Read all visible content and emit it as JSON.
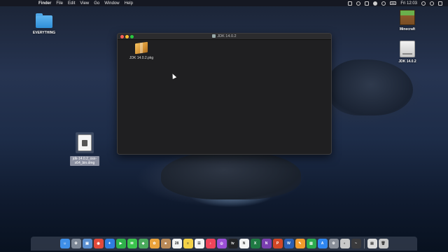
{
  "menubar": {
    "apple_glyph": "",
    "items": [
      "Finder",
      "File",
      "Edit",
      "View",
      "Go",
      "Window",
      "Help"
    ],
    "clock": "Fri 12:03"
  },
  "desktop_icons": {
    "everything_folder": "EVERYTHING",
    "minecraft": "Minecraft",
    "drive": "JDK 14.0.2",
    "dmg_line1": "jdk-14.0.2_osx-",
    "dmg_line2": "x64_bin.dmg"
  },
  "window": {
    "title": "JDK 14.0.2",
    "items": [
      {
        "label": "JDK 14.0.2.pkg",
        "icon": "package-icon"
      }
    ]
  },
  "dock": {
    "apps": [
      {
        "name": "finder",
        "color": "#3f8fe8",
        "glyph": "☺"
      },
      {
        "name": "launchpad",
        "color": "#7d8796",
        "glyph": "⚙"
      },
      {
        "name": "preview",
        "color": "#5b8fd0",
        "glyph": "▣"
      },
      {
        "name": "chrome",
        "color": "#e24a3b",
        "glyph": "◉"
      },
      {
        "name": "safari",
        "color": "#2f7de1",
        "glyph": "✦"
      },
      {
        "name": "facetime",
        "color": "#2fb24a",
        "glyph": "▶"
      },
      {
        "name": "messages",
        "color": "#3bc44d",
        "glyph": "✉"
      },
      {
        "name": "maps",
        "color": "#4aa95c",
        "glyph": "◆"
      },
      {
        "name": "photos",
        "color": "#e9a23b",
        "glyph": "✿"
      },
      {
        "name": "contacts",
        "color": "#b98a58",
        "glyph": "■"
      },
      {
        "name": "calendar",
        "color": "#f2f2f2",
        "glyph": "28"
      },
      {
        "name": "notes",
        "color": "#f5d247",
        "glyph": "≡"
      },
      {
        "name": "reminders",
        "color": "#f4f4f4",
        "glyph": "☰"
      },
      {
        "name": "music",
        "color": "#f0445a",
        "glyph": "♪"
      },
      {
        "name": "podcasts",
        "color": "#9a4fd6",
        "glyph": "◎"
      },
      {
        "name": "tv",
        "color": "#222326",
        "glyph": "tv"
      },
      {
        "name": "news",
        "color": "#f3f3f3",
        "glyph": "N"
      },
      {
        "name": "excel",
        "color": "#1f7a43",
        "glyph": "X"
      },
      {
        "name": "onenote",
        "color": "#7a3fb0",
        "glyph": "N"
      },
      {
        "name": "powerpoint",
        "color": "#d24726",
        "glyph": "P"
      },
      {
        "name": "word",
        "color": "#2b5fb4",
        "glyph": "W"
      },
      {
        "name": "pages",
        "color": "#f29b2c",
        "glyph": "✎"
      },
      {
        "name": "numbers",
        "color": "#2cab4e",
        "glyph": "▥"
      },
      {
        "name": "app-store",
        "color": "#2f86f0",
        "glyph": "A"
      },
      {
        "name": "system-preferences",
        "color": "#8a8f99",
        "glyph": "⚙"
      },
      {
        "name": "disk-utility",
        "color": "#c9c9c9",
        "glyph": "◐"
      },
      {
        "name": "activity-monitor",
        "color": "#3a3a3c",
        "glyph": "~"
      }
    ],
    "trailing": [
      {
        "name": "downloads-stack",
        "color": "#dcdcdc",
        "glyph": "▤"
      },
      {
        "name": "trash",
        "color": "#c8c8c8",
        "glyph": "🗑"
      }
    ]
  }
}
